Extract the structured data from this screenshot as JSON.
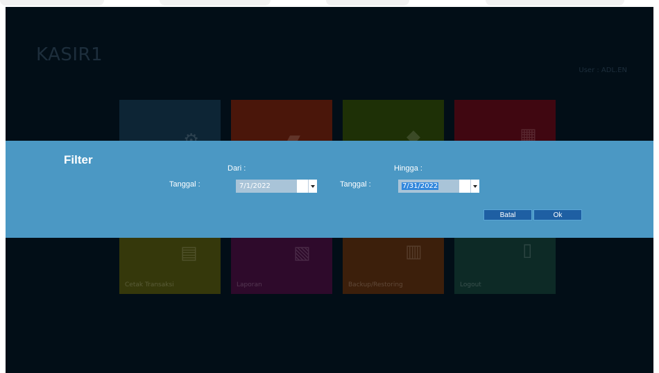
{
  "app": {
    "title": "KASIR1",
    "user_label": "User : ADL.EN"
  },
  "tiles": [
    {
      "label": "",
      "icon": "gear-icon"
    },
    {
      "label": "",
      "icon": "cart-icon"
    },
    {
      "label": "",
      "icon": "box-icon"
    },
    {
      "label": "",
      "icon": "calendar-icon"
    },
    {
      "label": "Cetak Transaksi",
      "icon": "printer-icon"
    },
    {
      "label": "Laporan",
      "icon": "report-icon"
    },
    {
      "label": "Backup/Restoring",
      "icon": "backup-icon"
    },
    {
      "label": "Logout",
      "icon": "door-icon"
    }
  ],
  "filter": {
    "title": "Filter",
    "dari_label": "Dari :",
    "hingga_label": "Hingga :",
    "tanggal_label_1": "Tanggal :",
    "tanggal_label_2": "Tanggal :",
    "dari_value": "7/1/2022",
    "hingga_value": "7/31/2022",
    "batal_label": "Batal",
    "ok_label": "Ok"
  },
  "colors": {
    "panel": "#4b98c4",
    "button": "#1e5fa3",
    "background": "#020e17"
  }
}
